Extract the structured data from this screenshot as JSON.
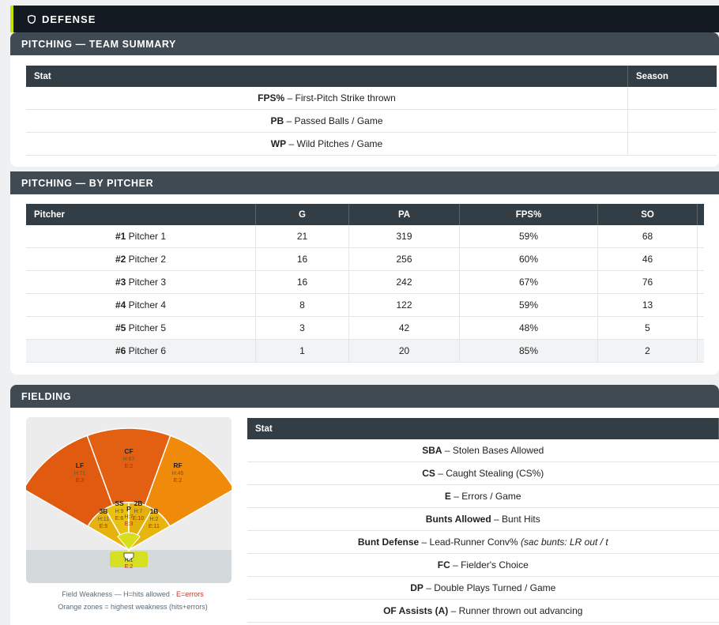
{
  "header": {
    "title": "DEFENSE",
    "icon": "shield-icon"
  },
  "team_summary": {
    "title": "PITCHING — TEAM SUMMARY",
    "columns": [
      "Stat",
      "Season"
    ],
    "rows": [
      {
        "abbr": "FPS%",
        "desc": "– First-Pitch Strike thrown",
        "season": ""
      },
      {
        "abbr": "PB",
        "desc": "– Passed Balls / Game",
        "season": ""
      },
      {
        "abbr": "WP",
        "desc": "– Wild Pitches / Game",
        "season": ""
      }
    ]
  },
  "by_pitcher": {
    "title": "PITCHING — BY PITCHER",
    "columns": [
      "Pitcher",
      "G",
      "PA",
      "FPS%",
      "SO"
    ],
    "rows": [
      {
        "num": "#1",
        "name": "Pitcher 1",
        "g": "21",
        "pa": "319",
        "fps": "59%",
        "so": "68"
      },
      {
        "num": "#2",
        "name": "Pitcher 2",
        "g": "16",
        "pa": "256",
        "fps": "60%",
        "so": "46"
      },
      {
        "num": "#3",
        "name": "Pitcher 3",
        "g": "16",
        "pa": "242",
        "fps": "67%",
        "so": "76"
      },
      {
        "num": "#4",
        "name": "Pitcher 4",
        "g": "8",
        "pa": "122",
        "fps": "59%",
        "so": "13"
      },
      {
        "num": "#5",
        "name": "Pitcher 5",
        "g": "3",
        "pa": "42",
        "fps": "48%",
        "so": "5"
      },
      {
        "num": "#6",
        "name": "Pitcher 6",
        "g": "1",
        "pa": "20",
        "fps": "85%",
        "so": "2"
      }
    ]
  },
  "fielding": {
    "title": "FIELDING",
    "field": {
      "positions": [
        {
          "pos": "LF",
          "h": "H:71",
          "e": "E:3",
          "color": "#e05a10"
        },
        {
          "pos": "CF",
          "h": "H:67",
          "e": "E:2",
          "color": "#e35f12"
        },
        {
          "pos": "RF",
          "h": "H:45",
          "e": "E:2",
          "color": "#f08a0a"
        },
        {
          "pos": "3B",
          "h": "H:11",
          "e": "E:5",
          "color": "#e6b20e"
        },
        {
          "pos": "SS",
          "h": "H:9",
          "e": "E:6",
          "color": "#e8c20e"
        },
        {
          "pos": "2B",
          "h": "H:7",
          "e": "E:10",
          "color": "#e4b00c"
        },
        {
          "pos": "1B",
          "h": "H:2",
          "e": "E:11",
          "color": "#e8b40e"
        },
        {
          "pos": "P",
          "h": "H:7",
          "e": "E:3",
          "color": "#d8df1a"
        },
        {
          "pos": "C",
          "h": "H:1",
          "e": "E:2",
          "color": "#d4e021"
        }
      ],
      "legend_line1": "Field Weakness — H=hits allowed ·",
      "legend_errors": "E=errors",
      "legend_line2": "Orange zones = highest weakness (hits+errors)"
    },
    "table": {
      "columns": [
        "Stat"
      ],
      "rows": [
        {
          "abbr": "SBA",
          "desc": "– Stolen Bases Allowed"
        },
        {
          "abbr": "CS",
          "desc": "– Caught Stealing (CS%)"
        },
        {
          "abbr": "E",
          "desc": "– Errors / Game"
        },
        {
          "abbr": "Bunts Allowed",
          "desc": "– Bunt Hits"
        },
        {
          "abbr": "Bunt Defense",
          "desc": "– Lead-Runner Conv% ",
          "desc_italic": "(sac bunts: LR out / t"
        },
        {
          "abbr": "FC",
          "desc": "– Fielder's Choice"
        },
        {
          "abbr": "DP",
          "desc": "– Double Plays Turned / Game"
        },
        {
          "abbr": "OF Assists (A)",
          "desc": "– Runner thrown out advancing"
        }
      ]
    }
  }
}
